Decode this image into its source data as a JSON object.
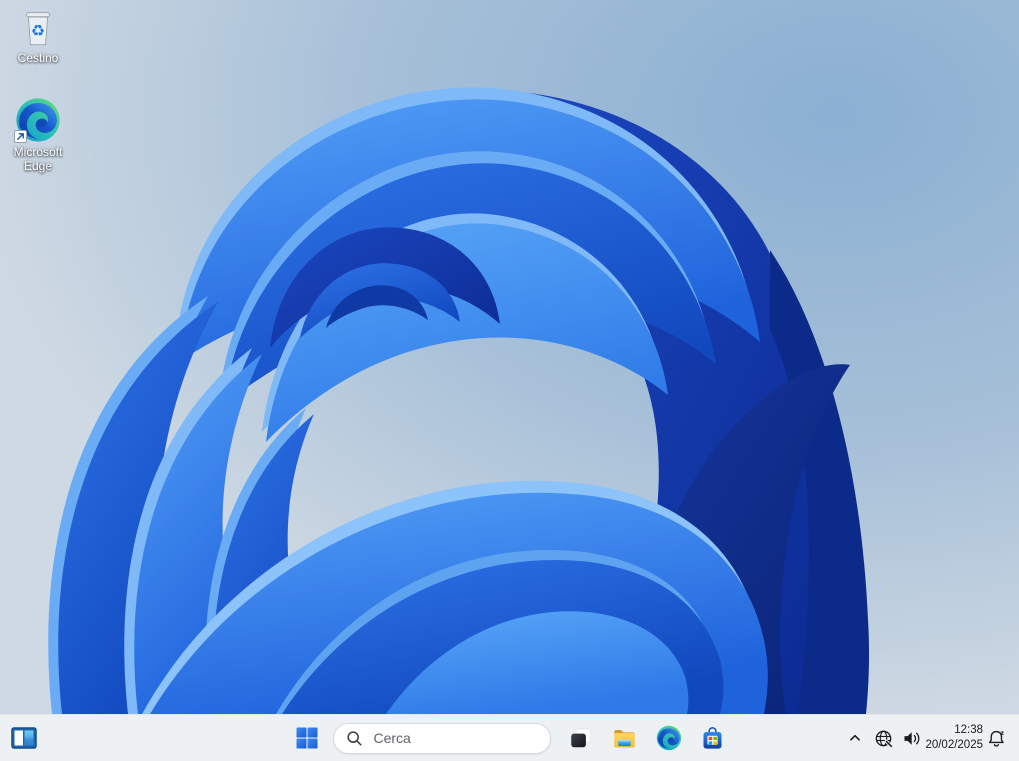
{
  "desktop": {
    "icons": [
      {
        "label": "Cestino",
        "icon": "recycle-bin-icon"
      },
      {
        "label": "Microsoft Edge",
        "icon": "edge-icon"
      }
    ]
  },
  "taskbar": {
    "search_placeholder": "Cerca",
    "apps": [
      "task-view-icon",
      "file-explorer-icon",
      "microsoft-edge-icon",
      "microsoft-store-icon"
    ],
    "corner_icon": "widgets-icon",
    "start_icon": "windows-logo-icon",
    "tray": {
      "time": "12:38",
      "date": "20/02/2025",
      "icons": [
        "chevron-up-icon",
        "globe-no-internet-icon",
        "speaker-icon",
        "bell-dnd-icon"
      ]
    }
  },
  "colors": {
    "taskbar_bg": "#eef1f4",
    "search_border": "#d8dadd",
    "windows_blue": "#1f63d6",
    "wallpaper_dark_navy": "#0c2a8a",
    "wallpaper_bright_blue": "#2e7ae8",
    "background_steel_blue": "#8fb3d4",
    "background_light": "#cdd7e2",
    "tray_icon_color": "#1c1c1c"
  }
}
